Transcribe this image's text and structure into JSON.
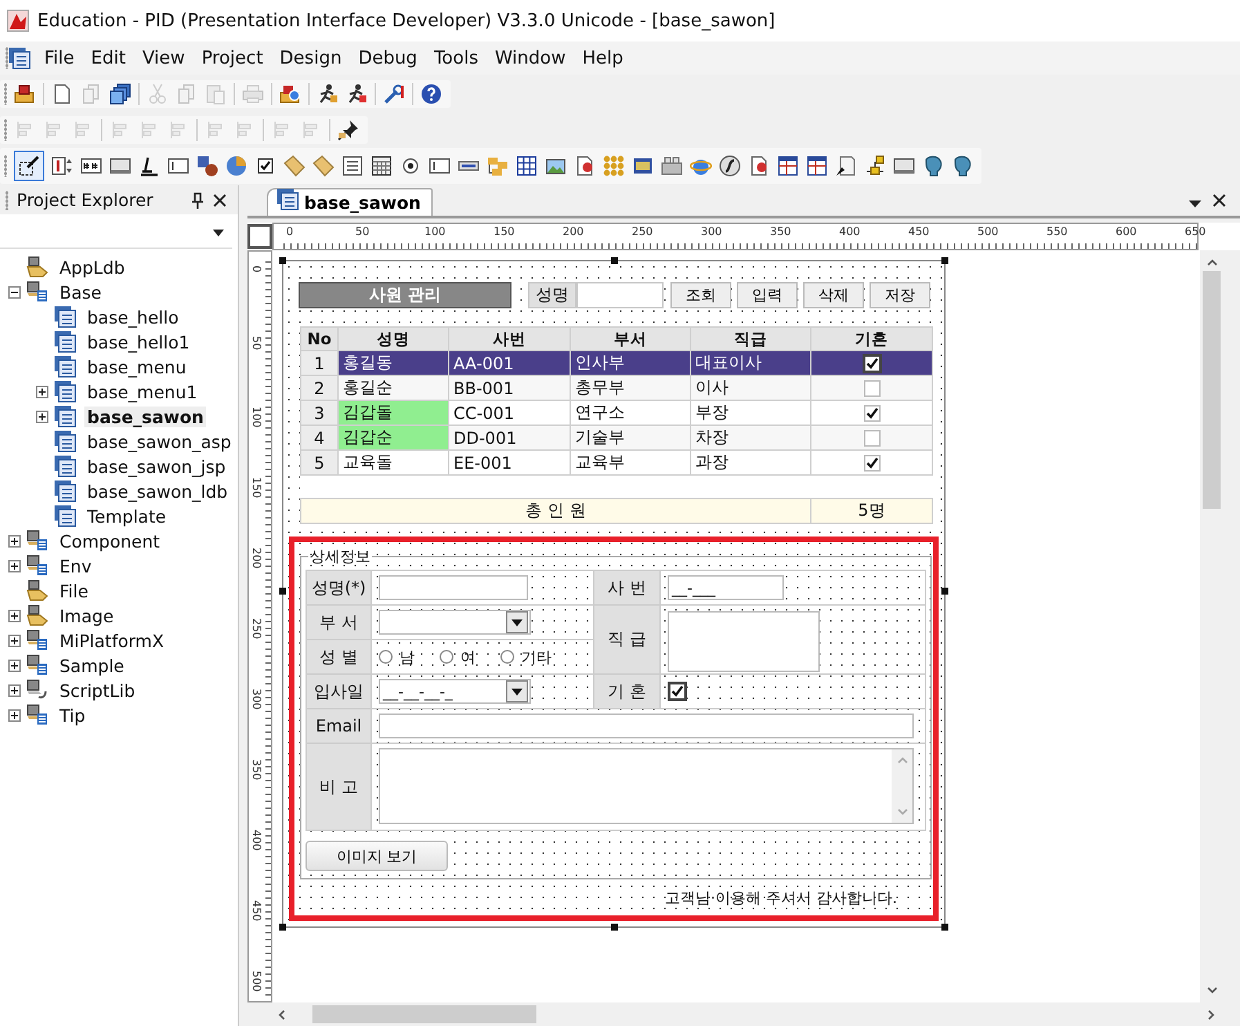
{
  "window": {
    "title": "Education - PID (Presentation Interface Developer) V3.3.0 Unicode - [base_sawon]"
  },
  "menu": [
    "File",
    "Edit",
    "View",
    "Project",
    "Design",
    "Debug",
    "Tools",
    "Window",
    "Help"
  ],
  "toolbox": {
    "pointer_selected": true
  },
  "project_explorer": {
    "title": "Project Explorer",
    "tree": [
      {
        "label": "AppLdb",
        "kind": "folder",
        "selected": false
      },
      {
        "label": "Base",
        "kind": "library",
        "expanded": true,
        "selected": false,
        "children": [
          {
            "label": "base_hello",
            "kind": "form",
            "selected": false
          },
          {
            "label": "base_hello1",
            "kind": "form",
            "selected": false
          },
          {
            "label": "base_menu",
            "kind": "form",
            "selected": false
          },
          {
            "label": "base_menu1",
            "kind": "form",
            "expanded": false,
            "selected": false
          },
          {
            "label": "base_sawon",
            "kind": "form",
            "expanded": false,
            "selected": true
          },
          {
            "label": "base_sawon_asp",
            "kind": "form",
            "selected": false
          },
          {
            "label": "base_sawon_jsp",
            "kind": "form",
            "selected": false
          },
          {
            "label": "base_sawon_ldb",
            "kind": "form",
            "selected": false
          },
          {
            "label": "Template",
            "kind": "form",
            "selected": false
          }
        ]
      },
      {
        "label": "Component",
        "kind": "library",
        "expanded": false,
        "selected": false
      },
      {
        "label": "Env",
        "kind": "library",
        "expanded": false,
        "selected": false
      },
      {
        "label": "File",
        "kind": "folder",
        "selected": false
      },
      {
        "label": "Image",
        "kind": "folder",
        "expanded": false,
        "selected": false
      },
      {
        "label": "MiPlatformX",
        "kind": "library",
        "expanded": false,
        "selected": false
      },
      {
        "label": "Sample",
        "kind": "library",
        "expanded": false,
        "selected": false
      },
      {
        "label": "ScriptLib",
        "kind": "script",
        "expanded": false,
        "selected": false
      },
      {
        "label": "Tip",
        "kind": "library",
        "expanded": false,
        "selected": false
      }
    ]
  },
  "editor_tab": {
    "label": "base_sawon",
    "selected": true
  },
  "rulers": {
    "horizontal": [
      "0",
      "50",
      "100",
      "150",
      "200",
      "250",
      "300",
      "350",
      "400",
      "450",
      "500",
      "550",
      "600",
      "650"
    ],
    "vertical": [
      "0",
      "50",
      "100",
      "150",
      "200",
      "250",
      "300",
      "350",
      "400",
      "450",
      "500"
    ]
  },
  "form": {
    "title": "사원 관리",
    "search_label": "성명",
    "buttons": [
      "조회",
      "입력",
      "삭제",
      "저장"
    ],
    "grid": {
      "columns": [
        "No",
        "성명",
        "사번",
        "부서",
        "직급",
        "기혼"
      ],
      "rows": [
        {
          "no": "1",
          "name": "홍길동",
          "id": "AA-001",
          "dept": "인사부",
          "rank": "대표이사",
          "married": true,
          "selected": true,
          "name_highlight": false
        },
        {
          "no": "2",
          "name": "홍길순",
          "id": "BB-001",
          "dept": "총무부",
          "rank": "이사",
          "married": false,
          "selected": false,
          "name_highlight": false
        },
        {
          "no": "3",
          "name": "김갑돌",
          "id": "CC-001",
          "dept": "연구소",
          "rank": "부장",
          "married": true,
          "selected": false,
          "name_highlight": true
        },
        {
          "no": "4",
          "name": "김갑순",
          "id": "DD-001",
          "dept": "기술부",
          "rank": "차장",
          "married": false,
          "selected": false,
          "name_highlight": true
        },
        {
          "no": "5",
          "name": "교육돌",
          "id": "EE-001",
          "dept": "교육부",
          "rank": "과장",
          "married": true,
          "selected": false,
          "name_highlight": false
        }
      ],
      "total_label": "총 인 원",
      "total_value": "5명"
    },
    "detail": {
      "title": "상세정보",
      "name_label": "성명(*)",
      "emp_no_label": "사 번",
      "emp_no_mask": "__-___",
      "dept_label": "부 서",
      "rank_label": "직 급",
      "gender_label": "성 별",
      "gender_options": [
        {
          "label": "남",
          "selected": false
        },
        {
          "label": "여",
          "selected": false
        },
        {
          "label": "기타",
          "selected": false
        }
      ],
      "join_label": "입사일",
      "join_mask": "__-__-__-_",
      "married_label": "기 혼",
      "married": true,
      "email_label": "Email",
      "remark_label": "비 고",
      "image_button": "이미지 보기"
    },
    "footer_text": "고객님·이용해 주셔서 감사합니다."
  }
}
